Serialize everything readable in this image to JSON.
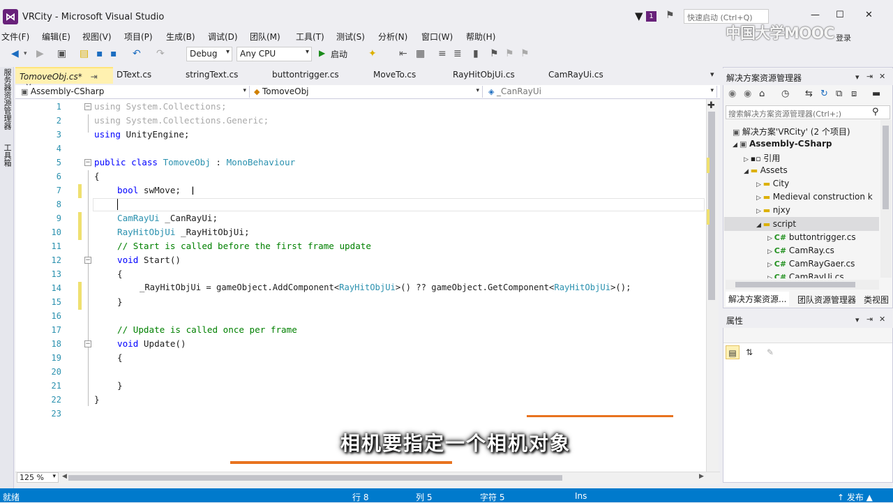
{
  "window": {
    "title": "VRCity - Microsoft Visual Studio",
    "notifications": "1",
    "quick_launch_placeholder": "快速启动 (Ctrl+Q)",
    "watermark": "中国大学MOOC",
    "login": "登录"
  },
  "menu": [
    "文件(F)",
    "编辑(E)",
    "视图(V)",
    "项目(P)",
    "生成(B)",
    "调试(D)",
    "团队(M)",
    "工具(T)",
    "测试(S)",
    "分析(N)",
    "窗口(W)",
    "帮助(H)"
  ],
  "toolbar": {
    "config": "Debug",
    "platform": "Any CPU",
    "start": "启动"
  },
  "left_strip": {
    "server_explorer": "服务器资源管理器",
    "toolbox": "工具箱"
  },
  "tabs": [
    {
      "label": "TomoveObj.cs*",
      "pin": "⇥",
      "close": "✕"
    },
    {
      "label": "DText.cs"
    },
    {
      "label": "stringText.cs"
    },
    {
      "label": "buttontrigger.cs"
    },
    {
      "label": "MoveTo.cs"
    },
    {
      "label": "RayHitObjUi.cs"
    },
    {
      "label": "CamRayUi.cs"
    }
  ],
  "nav": {
    "project": "Assembly-CSharp",
    "class": "TomoveObj",
    "member": "_CanRayUi"
  },
  "code": {
    "line_numbers": [
      "1",
      "2",
      "3",
      "4",
      "5",
      "6",
      "7",
      "8",
      "9",
      "10",
      "11",
      "12",
      "13",
      "14",
      "15",
      "16",
      "17",
      "18",
      "19",
      "20",
      "21",
      "22",
      "23"
    ],
    "l1_kw": "using",
    "l1_ns": " System.Collections;",
    "l2_kw": "using",
    "l2_ns": " System.Collections.Generic;",
    "l3_kw": "using",
    "l3_ns": " UnityEngine;",
    "l5_kw1": "public",
    "l5_kw2": " class",
    "l5_name": " TomoveObj",
    "l5_colon": " : ",
    "l5_base": "MonoBehaviour",
    "l6": "{",
    "l7_kw": "bool",
    "l7_rest": " swMove;",
    "l9_ty": "CamRayUi",
    "l9_rest": " _CanRayUi;",
    "l10_ty": "RayHitObjUi",
    "l10_rest": " _RayHitObjUi;",
    "l11": "// Start is called before the first frame update",
    "l12_kw": "void",
    "l12_rest": " Start()",
    "l13": "{",
    "l14_a": "_RayHitObjUi = gameObject.AddComponent<",
    "l14_ty1": "RayHitObjUi",
    "l14_b": ">() ?? gameObject.GetComponent<",
    "l14_ty2": "RayHitObjUi",
    "l14_c": ">();",
    "l15": "}",
    "l17": "// Update is called once per frame",
    "l18_kw": "void",
    "l18_rest": " Update()",
    "l19": "{",
    "l21": "}",
    "l22": "}"
  },
  "zoom": "125 %",
  "subtitle": "相机要指定一个相机对象",
  "solution_explorer": {
    "title": "解决方案资源管理器",
    "search_placeholder": "搜索解决方案资源管理器(Ctrl+;)",
    "items": [
      {
        "label": "解决方案'VRCity' (2 个项目)"
      },
      {
        "label": "Assembly-CSharp"
      },
      {
        "label": "引用"
      },
      {
        "label": "Assets"
      },
      {
        "label": "City"
      },
      {
        "label": "Medieval construction k"
      },
      {
        "label": "njxy"
      },
      {
        "label": "script"
      },
      {
        "label": "buttontrigger.cs"
      },
      {
        "label": "CamRay.cs"
      },
      {
        "label": "CamRayGaer.cs"
      },
      {
        "label": "CamRayUi.cs"
      }
    ],
    "tabs": [
      "解决方案资源...",
      "团队资源管理器",
      "类视图"
    ]
  },
  "properties": {
    "title": "属性"
  },
  "status": {
    "ready": "就绪",
    "line": "行 8",
    "col": "列 5",
    "char": "字符 5",
    "mode": "Ins",
    "publish": "↑ 发布 ▲"
  },
  "colors": {
    "accent": "#68217a",
    "statusbar": "#007acc",
    "keyword": "#0000ff",
    "type": "#2b91af",
    "comment": "#008000",
    "subtitle_line": "#e8731f"
  }
}
